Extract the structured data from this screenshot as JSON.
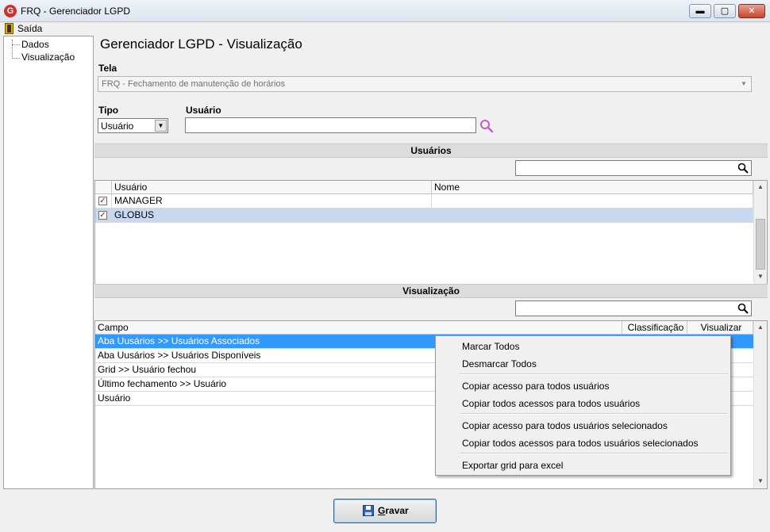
{
  "window": {
    "title": "FRQ - Gerenciador LGPD",
    "logo_letter": "G",
    "minimize_glyph": "▬",
    "maximize_glyph": "▢",
    "close_glyph": "✕"
  },
  "menu": {
    "exit_label": "Saída"
  },
  "tree": {
    "items": [
      {
        "label": "Dados"
      },
      {
        "label": "Visualização"
      }
    ]
  },
  "page": {
    "title": "Gerenciador LGPD - Visualização"
  },
  "tela": {
    "label": "Tela",
    "value": "FRQ - Fechamento de manutenção de horários"
  },
  "tipo": {
    "label": "Tipo",
    "value": "Usuário"
  },
  "usuario_field": {
    "label": "Usuário",
    "value": ""
  },
  "users_section": {
    "title": "Usuários",
    "filter_value": "",
    "columns": [
      "Usuário",
      "Nome"
    ],
    "rows": [
      {
        "checked": true,
        "usuario": "MANAGER",
        "nome": "",
        "selected": false
      },
      {
        "checked": true,
        "usuario": "GLOBUS",
        "nome": "",
        "selected": true
      }
    ]
  },
  "vis_section": {
    "title": "Visualização",
    "filter_value": "",
    "columns": [
      "Campo",
      "Classificação",
      "Visualizar"
    ],
    "rows": [
      {
        "campo": "Aba Uusários >> Usuários Associados",
        "selected": true
      },
      {
        "campo": "Aba Uusários >> Usuários Disponíveis",
        "selected": false
      },
      {
        "campo": "Grid >> Usuário fechou",
        "selected": false
      },
      {
        "campo": "Último fechamento >> Usuário",
        "selected": false
      },
      {
        "campo": "Usuário",
        "selected": false
      }
    ]
  },
  "context_menu": {
    "items": [
      "Marcar Todos",
      "Desmarcar Todos",
      "Copiar acesso para todos usuários",
      "Copiar todos acessos para todos usuários",
      "Copiar acesso para todos usuários selecionados",
      "Copiar todos acessos para todos usuários selecionados",
      "Exportar grid para excel"
    ]
  },
  "footer": {
    "save_label_first": "G",
    "save_label_rest": "ravar"
  },
  "colors": {
    "selection_blue": "#3399ff",
    "row_highlight": "#c6d8f2",
    "check_red": "#cc0000"
  },
  "icons": [
    "app-logo-icon",
    "exit-door-icon",
    "search-icon",
    "save-disk-icon"
  ]
}
